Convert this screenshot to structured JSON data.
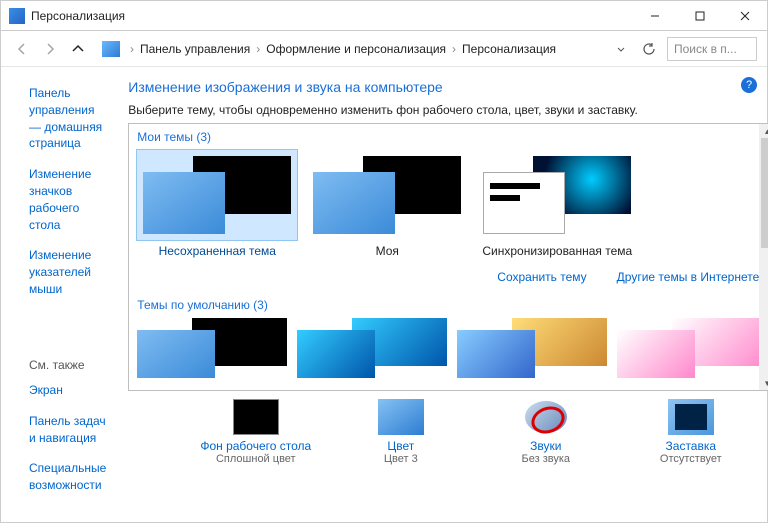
{
  "window": {
    "title": "Персонализация"
  },
  "breadcrumb": {
    "items": [
      "Панель управления",
      "Оформление и персонализация",
      "Персонализация"
    ]
  },
  "search": {
    "placeholder": "Поиск в п..."
  },
  "sidebar": {
    "links": [
      "Панель управления — домашняя страница",
      "Изменение значков рабочего стола",
      "Изменение указателей мыши"
    ],
    "see_also_label": "См. также",
    "see_also": [
      "Экран",
      "Панель задач и навигация",
      "Специальные возможности"
    ]
  },
  "page": {
    "title": "Изменение изображения и звука на компьютере",
    "description": "Выберите тему, чтобы одновременно изменить фон рабочего стола, цвет, звуки и заставку."
  },
  "sections": {
    "my_themes_label": "Мои темы (3)",
    "default_themes_label": "Темы по умолчанию (3)"
  },
  "themes": [
    {
      "label": "Несохраненная тема",
      "selected": true,
      "type": "std"
    },
    {
      "label": "Моя",
      "selected": false,
      "type": "std"
    },
    {
      "label": "Синхронизированная тема",
      "selected": false,
      "type": "sync"
    }
  ],
  "theme_actions": {
    "save": "Сохранить тему",
    "more": "Другие темы в Интернете"
  },
  "settings": [
    {
      "name": "Фон рабочего стола",
      "value": "Сплошной цвет",
      "icon": "desktop"
    },
    {
      "name": "Цвет",
      "value": "Цвет 3",
      "icon": "color"
    },
    {
      "name": "Звуки",
      "value": "Без звука",
      "icon": "sound"
    },
    {
      "name": "Заставка",
      "value": "Отсутствует",
      "icon": "saver"
    }
  ]
}
